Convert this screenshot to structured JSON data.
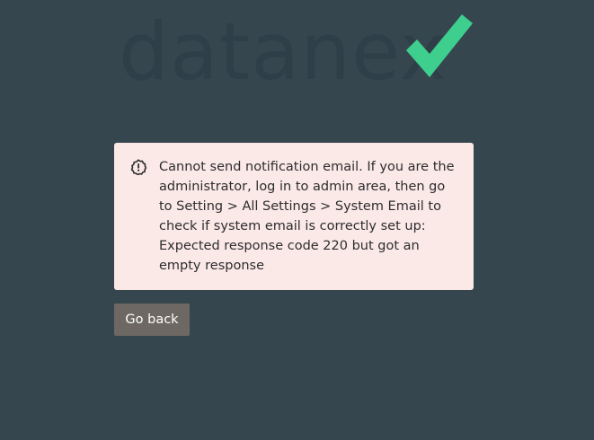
{
  "logo": {
    "text": "datanex",
    "text_color": "#2e3f49",
    "check_color": "#3ecf8e",
    "check_icon": "checkmark-icon"
  },
  "alert": {
    "icon": "alert-badge-icon",
    "background": "#fbe9e8",
    "message_lines": [
      "Cannot send notification email. If you are the",
      "administrator, log in to admin area, then go",
      "to Setting > All Settings > System Email to",
      "check if system email is correctly set up:",
      "Expected response code 220 but got an",
      "empty response"
    ]
  },
  "actions": {
    "go_back_label": "Go back",
    "go_back_color": "#6d6864"
  }
}
